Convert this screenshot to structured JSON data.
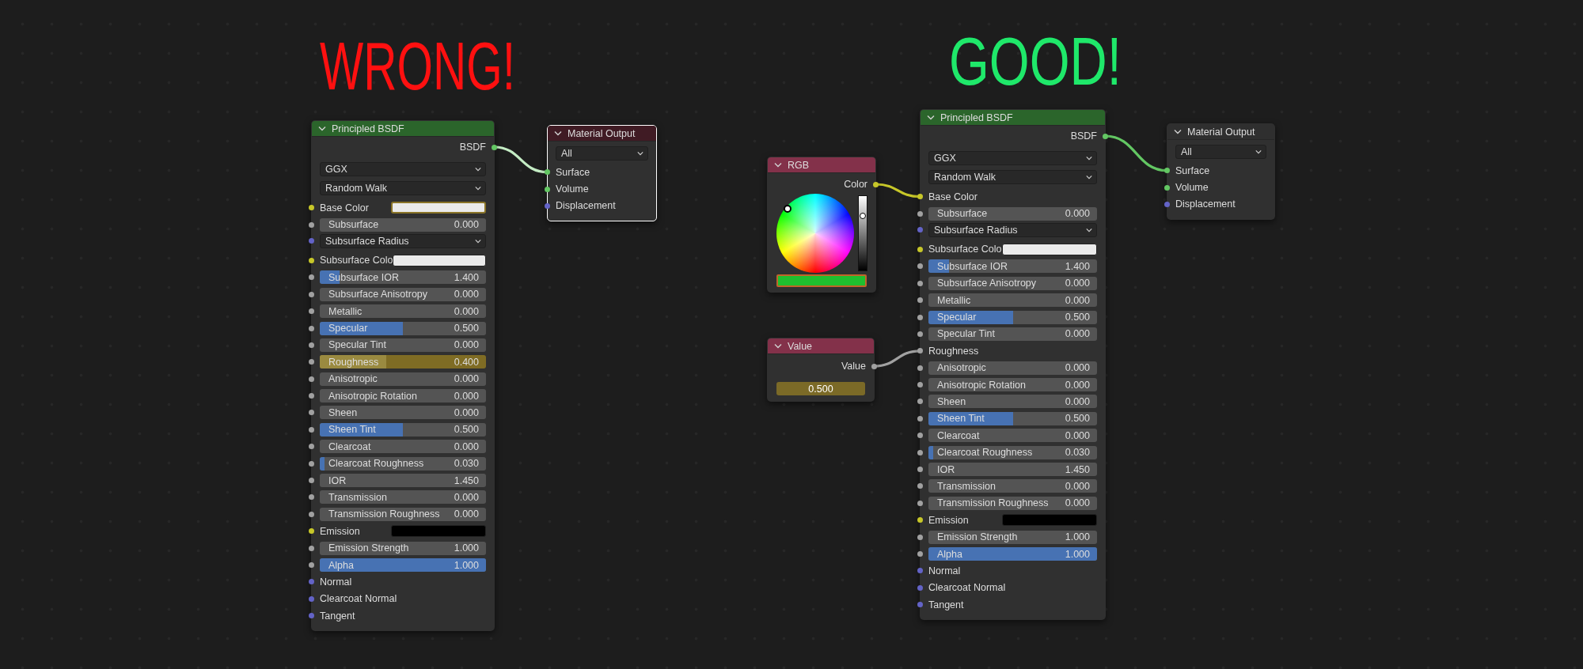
{
  "comparisons": [
    {
      "heading": "WRONG!",
      "kind": "wrong",
      "nodes": [
        {
          "kind": "principled",
          "title": "Principled BSDF",
          "selected": false,
          "rows": [
            {
              "kind": "output",
              "label": "BSDF",
              "socket": {
                "kind": "shader",
                "linked": true
              }
            },
            {
              "kind": "dropdown",
              "value": "GGX"
            },
            {
              "kind": "dropdown",
              "value": "Random Walk"
            },
            {
              "kind": "color",
              "label": "Base Color",
              "socket": {
                "kind": "color"
              },
              "color": "#ebebeb",
              "highlighted": true
            },
            {
              "kind": "slider",
              "label": "Subsurface",
              "value": "0.000",
              "level": 0,
              "socket": {
                "kind": "float"
              },
              "highlighted": false
            },
            {
              "kind": "dropdown",
              "value": "Subsurface Radius",
              "socket": {
                "kind": "vector"
              }
            },
            {
              "kind": "color",
              "label": "Subsurface Colo",
              "socket": {
                "kind": "color"
              },
              "color": "#ebebeb",
              "highlighted": false
            },
            {
              "kind": "slider",
              "label": "Subsurface IOR",
              "value": "1.400",
              "level": 0.12,
              "socket": {
                "kind": "float"
              },
              "highlighted": false
            },
            {
              "kind": "slider",
              "label": "Subsurface Anisotropy",
              "value": "0.000",
              "level": 0,
              "socket": {
                "kind": "float"
              },
              "highlighted": false
            },
            {
              "kind": "slider",
              "label": "Metallic",
              "value": "0.000",
              "level": 0,
              "socket": {
                "kind": "float"
              },
              "highlighted": false
            },
            {
              "kind": "slider",
              "label": "Specular",
              "value": "0.500",
              "level": 0.5,
              "socket": {
                "kind": "float"
              },
              "highlighted": false
            },
            {
              "kind": "slider",
              "label": "Specular Tint",
              "value": "0.000",
              "level": 0,
              "socket": {
                "kind": "float"
              },
              "highlighted": false
            },
            {
              "kind": "slider",
              "label": "Roughness",
              "value": "0.400",
              "level": 0.4,
              "socket": {
                "kind": "float"
              },
              "highlighted": true
            },
            {
              "kind": "slider",
              "label": "Anisotropic",
              "value": "0.000",
              "level": 0,
              "socket": {
                "kind": "float"
              },
              "highlighted": false
            },
            {
              "kind": "slider",
              "label": "Anisotropic Rotation",
              "value": "0.000",
              "level": 0,
              "socket": {
                "kind": "float"
              },
              "highlighted": false
            },
            {
              "kind": "slider",
              "label": "Sheen",
              "value": "0.000",
              "level": 0,
              "socket": {
                "kind": "float"
              },
              "highlighted": false
            },
            {
              "kind": "slider",
              "label": "Sheen Tint",
              "value": "0.500",
              "level": 0.5,
              "socket": {
                "kind": "float"
              },
              "highlighted": false
            },
            {
              "kind": "slider",
              "label": "Clearcoat",
              "value": "0.000",
              "level": 0,
              "socket": {
                "kind": "float"
              },
              "highlighted": false
            },
            {
              "kind": "slider",
              "label": "Clearcoat Roughness",
              "value": "0.030",
              "level": 0.03,
              "socket": {
                "kind": "float"
              },
              "highlighted": false
            },
            {
              "kind": "slider",
              "label": "IOR",
              "value": "1.450",
              "level": 0,
              "socket": {
                "kind": "float"
              },
              "highlighted": false
            },
            {
              "kind": "slider",
              "label": "Transmission",
              "value": "0.000",
              "level": 0,
              "socket": {
                "kind": "float"
              },
              "highlighted": false
            },
            {
              "kind": "slider",
              "label": "Transmission Roughness",
              "value": "0.000",
              "level": 0,
              "socket": {
                "kind": "float"
              },
              "highlighted": false
            },
            {
              "kind": "color",
              "label": "Emission",
              "socket": {
                "kind": "color"
              },
              "color": "#000000",
              "highlighted": false
            },
            {
              "kind": "slider",
              "label": "Emission Strength",
              "value": "1.000",
              "level": 0,
              "socket": {
                "kind": "float"
              },
              "highlighted": false
            },
            {
              "kind": "slider",
              "label": "Alpha",
              "value": "1.000",
              "level": 1,
              "socket": {
                "kind": "float"
              },
              "highlighted": false
            },
            {
              "kind": "input",
              "label": "Normal",
              "socket": {
                "kind": "vector"
              }
            },
            {
              "kind": "input",
              "label": "Clearcoat Normal",
              "socket": {
                "kind": "vector"
              }
            },
            {
              "kind": "input",
              "label": "Tangent",
              "socket": {
                "kind": "vector"
              }
            }
          ]
        },
        {
          "kind": "output",
          "title": "Material Output",
          "selected": true,
          "rows": [
            {
              "kind": "dropdown",
              "value": "All"
            },
            {
              "kind": "input",
              "label": "Surface",
              "socket": {
                "kind": "shader",
                "linked": true
              }
            },
            {
              "kind": "input",
              "label": "Volume",
              "socket": {
                "kind": "shader"
              }
            },
            {
              "kind": "input",
              "label": "Displacement",
              "socket": {
                "kind": "vector"
              }
            }
          ]
        }
      ]
    },
    {
      "heading": "GOOD!",
      "kind": "good",
      "nodes": [
        {
          "kind": "rgb",
          "title": "RGB",
          "selected": false,
          "rows": [
            {
              "kind": "output",
              "label": "Color",
              "socket": {
                "kind": "color",
                "linked": true
              }
            },
            {
              "kind": "wheel"
            },
            {
              "kind": "swatch",
              "color": "#1fbf2f",
              "highlighted": true
            }
          ]
        },
        {
          "kind": "value",
          "title": "Value",
          "selected": false,
          "rows": [
            {
              "kind": "output",
              "label": "Value",
              "socket": {
                "kind": "float",
                "linked": true
              }
            },
            {
              "kind": "field",
              "value": "0.500",
              "highlighted": true
            }
          ]
        },
        {
          "kind": "principled",
          "title": "Principled BSDF",
          "selected": false,
          "rows": [
            {
              "kind": "output",
              "label": "BSDF",
              "socket": {
                "kind": "shader",
                "linked": true
              }
            },
            {
              "kind": "dropdown",
              "value": "GGX"
            },
            {
              "kind": "dropdown",
              "value": "Random Walk"
            },
            {
              "kind": "input",
              "label": "Base Color",
              "socket": {
                "kind": "color",
                "linked": true
              }
            },
            {
              "kind": "slider",
              "label": "Subsurface",
              "value": "0.000",
              "level": 0,
              "socket": {
                "kind": "float"
              },
              "highlighted": false
            },
            {
              "kind": "dropdown",
              "value": "Subsurface Radius",
              "socket": {
                "kind": "vector"
              }
            },
            {
              "kind": "color",
              "label": "Subsurface Colo",
              "socket": {
                "kind": "color"
              },
              "color": "#ebebeb",
              "highlighted": false
            },
            {
              "kind": "slider",
              "label": "Subsurface IOR",
              "value": "1.400",
              "level": 0.12,
              "socket": {
                "kind": "float"
              },
              "highlighted": false
            },
            {
              "kind": "slider",
              "label": "Subsurface Anisotropy",
              "value": "0.000",
              "level": 0,
              "socket": {
                "kind": "float"
              },
              "highlighted": false
            },
            {
              "kind": "slider",
              "label": "Metallic",
              "value": "0.000",
              "level": 0,
              "socket": {
                "kind": "float"
              },
              "highlighted": false
            },
            {
              "kind": "slider",
              "label": "Specular",
              "value": "0.500",
              "level": 0.5,
              "socket": {
                "kind": "float"
              },
              "highlighted": false
            },
            {
              "kind": "slider",
              "label": "Specular Tint",
              "value": "0.000",
              "level": 0,
              "socket": {
                "kind": "float"
              },
              "highlighted": false
            },
            {
              "kind": "input",
              "label": "Roughness",
              "socket": {
                "kind": "float",
                "linked": true
              }
            },
            {
              "kind": "slider",
              "label": "Anisotropic",
              "value": "0.000",
              "level": 0,
              "socket": {
                "kind": "float"
              },
              "highlighted": false
            },
            {
              "kind": "slider",
              "label": "Anisotropic Rotation",
              "value": "0.000",
              "level": 0,
              "socket": {
                "kind": "float"
              },
              "highlighted": false
            },
            {
              "kind": "slider",
              "label": "Sheen",
              "value": "0.000",
              "level": 0,
              "socket": {
                "kind": "float"
              },
              "highlighted": false
            },
            {
              "kind": "slider",
              "label": "Sheen Tint",
              "value": "0.500",
              "level": 0.5,
              "socket": {
                "kind": "float"
              },
              "highlighted": false
            },
            {
              "kind": "slider",
              "label": "Clearcoat",
              "value": "0.000",
              "level": 0,
              "socket": {
                "kind": "float"
              },
              "highlighted": false
            },
            {
              "kind": "slider",
              "label": "Clearcoat Roughness",
              "value": "0.030",
              "level": 0.03,
              "socket": {
                "kind": "float"
              },
              "highlighted": false
            },
            {
              "kind": "slider",
              "label": "IOR",
              "value": "1.450",
              "level": 0,
              "socket": {
                "kind": "float"
              },
              "highlighted": false
            },
            {
              "kind": "slider",
              "label": "Transmission",
              "value": "0.000",
              "level": 0,
              "socket": {
                "kind": "float"
              },
              "highlighted": false
            },
            {
              "kind": "slider",
              "label": "Transmission Roughness",
              "value": "0.000",
              "level": 0,
              "socket": {
                "kind": "float"
              },
              "highlighted": false
            },
            {
              "kind": "color",
              "label": "Emission",
              "socket": {
                "kind": "color"
              },
              "color": "#000000",
              "highlighted": false
            },
            {
              "kind": "slider",
              "label": "Emission Strength",
              "value": "1.000",
              "level": 0,
              "socket": {
                "kind": "float"
              },
              "highlighted": false
            },
            {
              "kind": "slider",
              "label": "Alpha",
              "value": "1.000",
              "level": 1,
              "socket": {
                "kind": "float"
              },
              "highlighted": false
            },
            {
              "kind": "input",
              "label": "Normal",
              "socket": {
                "kind": "vector"
              }
            },
            {
              "kind": "input",
              "label": "Clearcoat Normal",
              "socket": {
                "kind": "vector"
              }
            },
            {
              "kind": "input",
              "label": "Tangent",
              "socket": {
                "kind": "vector"
              }
            }
          ]
        },
        {
          "kind": "output",
          "title": "Material Output",
          "selected": false,
          "rows": [
            {
              "kind": "dropdown",
              "value": "All"
            },
            {
              "kind": "input",
              "label": "Surface",
              "socket": {
                "kind": "shader",
                "linked": true
              }
            },
            {
              "kind": "input",
              "label": "Volume",
              "socket": {
                "kind": "shader"
              }
            },
            {
              "kind": "input",
              "label": "Displacement",
              "socket": {
                "kind": "vector"
              }
            }
          ]
        }
      ]
    }
  ]
}
